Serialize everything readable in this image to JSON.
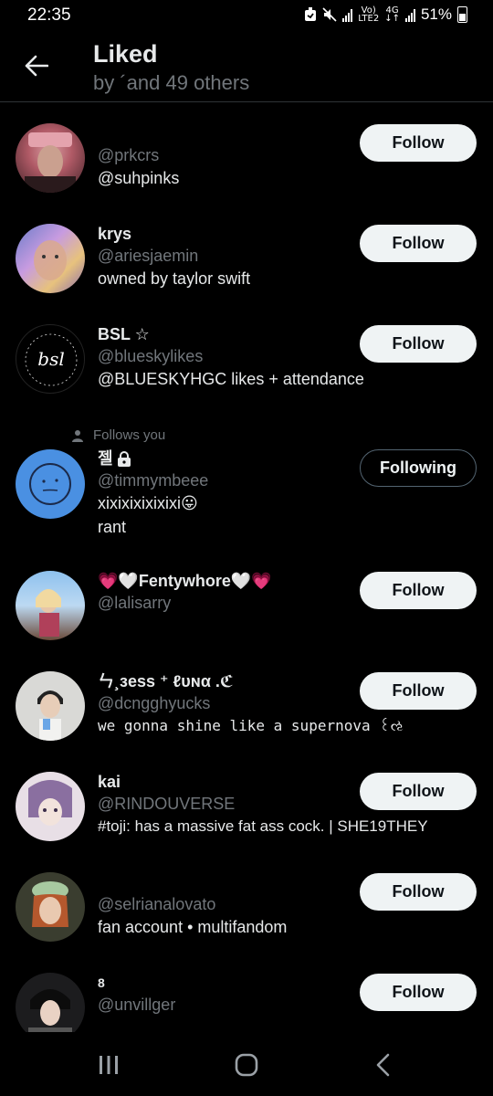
{
  "status": {
    "time": "22:35",
    "net_top": "Vo)",
    "net_bottom": "LTE2",
    "gen": "4G",
    "battery": "51%"
  },
  "header": {
    "title": "Liked",
    "subtitle": "by ´and 49 others"
  },
  "users": [
    {
      "name": "",
      "handle": "@prkcrs",
      "bio": "@suhpinks",
      "button": "Follow"
    },
    {
      "name": "krys",
      "handle": "@ariesjaemin",
      "bio": "owned by taylor swift",
      "button": "Follow"
    },
    {
      "name": "BSL ☆",
      "handle": "@blueskylikes",
      "bio": "@BLUESKYHGC likes + attendance",
      "button": "Follow",
      "avatar_text": "bsl"
    },
    {
      "follows_you": "Follows you",
      "name": "젤",
      "handle": "@timmymbeee",
      "bio": "xixixixixixixi😛",
      "bio2": "rant",
      "button": "Following"
    },
    {
      "name": "💗🤍Fentywhore🤍💗",
      "handle": "@lalisarry",
      "bio": "",
      "button": "Follow"
    },
    {
      "name": "ㄣ¸ɜess ⁺ ℓυɴα .ℭ",
      "handle": "@dcngghyucks",
      "bio": "we gonna shine like a supernova ꒰ઌ",
      "button": "Follow"
    },
    {
      "name": "kai",
      "handle": "@RINDOUVERSE",
      "bio": "#toji: has a massive fat ass cock. | SHE19THEY",
      "button": "Follow"
    },
    {
      "name": "",
      "handle": "@selrianalovato",
      "bio": "fan account • multifandom",
      "button": "Follow"
    },
    {
      "name": "8",
      "handle": "@unvillger",
      "bio": "",
      "button": "Follow"
    }
  ],
  "colors": {
    "background": "#000000",
    "primary_text": "#e7e9ea",
    "secondary_text": "#71767b",
    "follow_bg": "#eff3f4"
  }
}
